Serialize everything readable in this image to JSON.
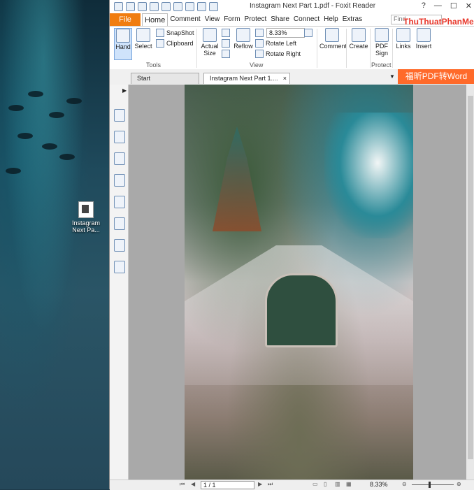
{
  "desktop": {
    "icon_label": "Instagram Next Pa..."
  },
  "window": {
    "title": "Instagram Next Part 1.pdf - Foxit Reader",
    "controls": [
      "?",
      "—",
      "☐",
      "✕"
    ]
  },
  "menu": {
    "file": "File",
    "tabs": [
      "Home",
      "Comment",
      "View",
      "Form",
      "Protect",
      "Share",
      "Connect",
      "Help",
      "Extras"
    ],
    "search_placeholder": "Find"
  },
  "ribbon": {
    "hand": "Hand",
    "select": "Select",
    "snapshot": "SnapShot",
    "clipboard": "Clipboard",
    "tools_group": "Tools",
    "actual_size": "Actual Size",
    "reflow": "Reflow",
    "zoom": "8.33%",
    "rotate_left": "Rotate Left",
    "rotate_right": "Rotate Right",
    "view_group": "View",
    "comment": "Comment",
    "create": "Create",
    "pdf_sign": "PDF Sign",
    "protect_group": "Protect",
    "links": "Links",
    "insert": "Insert"
  },
  "tabs": {
    "start": "Start",
    "document": "Instagram Next Part 1....",
    "close": "×"
  },
  "watermark": {
    "top": "ThuThuatPhanMem.vn",
    "banner": "福昕PDF转Word"
  },
  "statusbar": {
    "page": "1 / 1",
    "zoom": "8.33%"
  },
  "colors": {
    "file_tab": "#f07d10",
    "watermark_banner": "#ff6a2a",
    "hand_active": "#cfe3fb"
  }
}
